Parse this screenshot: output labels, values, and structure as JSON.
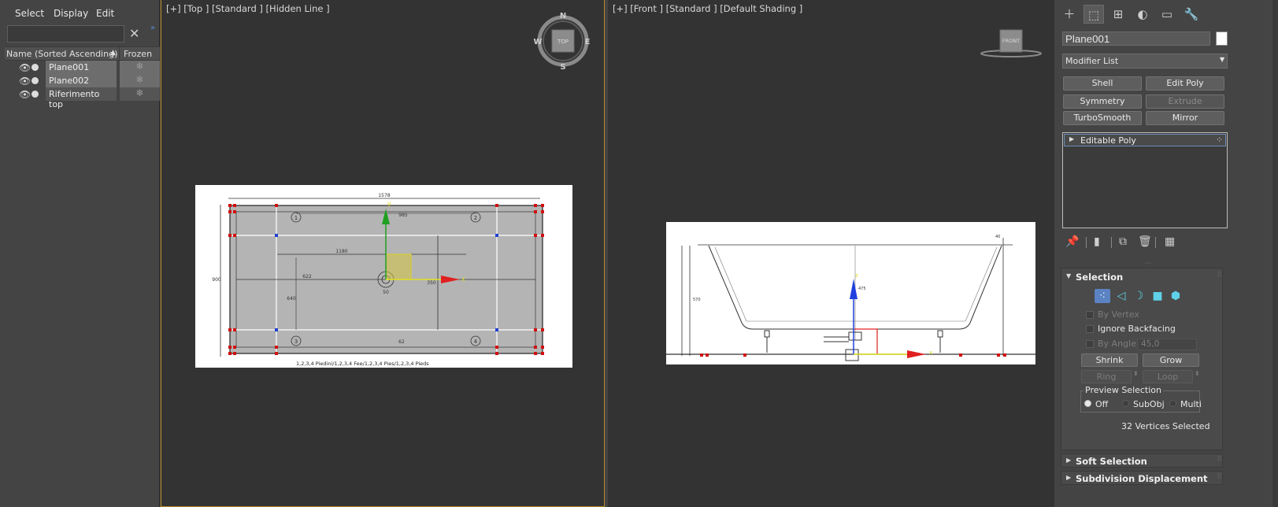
{
  "explorer": {
    "menu": [
      "Select",
      "Display",
      "Edit"
    ],
    "search_value": "",
    "columns": {
      "name": "Name (Sorted Ascending)",
      "frozen": "Frozen"
    },
    "objects": [
      {
        "name": "Plane001",
        "selected": true
      },
      {
        "name": "Plane002",
        "selected": true
      },
      {
        "name": "Riferimento top",
        "selected": false
      }
    ]
  },
  "viewports": {
    "top": {
      "label": "[+] [Top ] [Standard ] [Hidden Line ]",
      "viewcube": {
        "face": "TOP",
        "n": "N",
        "s": "S",
        "e": "E",
        "w": "W"
      },
      "gizmo": {
        "x": "x",
        "y": "y"
      },
      "drawing_text": {
        "dim_top": "1578",
        "dim_inner": "985",
        "dim_mid": "1180",
        "dim_left": "622",
        "dim_side": "900",
        "dim_v": "640",
        "dim_r": "350",
        "dim_c": "50",
        "dim_b": "62",
        "c1": "1",
        "c2": "2",
        "c3": "3",
        "c4": "4",
        "caption": "1,2,3,4 Piedini/1,2,3,4 Fee/1,2,3,4 Pies/1,2,3,4 Pieds"
      }
    },
    "front": {
      "label": "[+] [Front ] [Standard ] [Default Shading ]",
      "viewcube": {
        "face": "FRONT"
      },
      "gizmo": {
        "x": "x",
        "z": "z"
      },
      "drawing_text": {
        "dim_h": "570",
        "dim_c": "475",
        "dim_tr": "40"
      }
    }
  },
  "command_panel": {
    "tabs": [
      "create-icon",
      "modify-icon",
      "hierarchy-icon",
      "motion-icon",
      "display-icon",
      "utilities-icon"
    ],
    "object_name": "Plane001",
    "object_color": "#ffffff",
    "modifier_list": "Modifier List",
    "modifier_buttons": [
      {
        "label": "Shell",
        "enabled": true
      },
      {
        "label": "Edit Poly",
        "enabled": true
      },
      {
        "label": "Symmetry",
        "enabled": true
      },
      {
        "label": "Extrude",
        "enabled": false
      },
      {
        "label": "TurboSmooth",
        "enabled": true
      },
      {
        "label": "Mirror",
        "enabled": true
      }
    ],
    "stack_item": "Editable Poly",
    "selection": {
      "title": "Selection",
      "by_vertex": "By Vertex",
      "ignore_backfacing": "Ignore Backfacing",
      "by_angle": "By Angle:",
      "angle_value": "45,0",
      "shrink": "Shrink",
      "grow": "Grow",
      "ring": "Ring",
      "loop": "Loop",
      "preview_title": "Preview Selection",
      "preview_off": "Off",
      "preview_subobj": "SubObj",
      "preview_multi": "Multi",
      "status": "32 Vertices Selected"
    },
    "soft_selection": "Soft Selection",
    "subdivision_displacement": "Subdivision Displacement"
  },
  "colors": {
    "accent_border": "#b68b24",
    "subobj_active": "#5b82c2",
    "gizmo_x": "#e02020",
    "gizmo_y": "#20a020",
    "gizmo_z": "#2040e0"
  }
}
